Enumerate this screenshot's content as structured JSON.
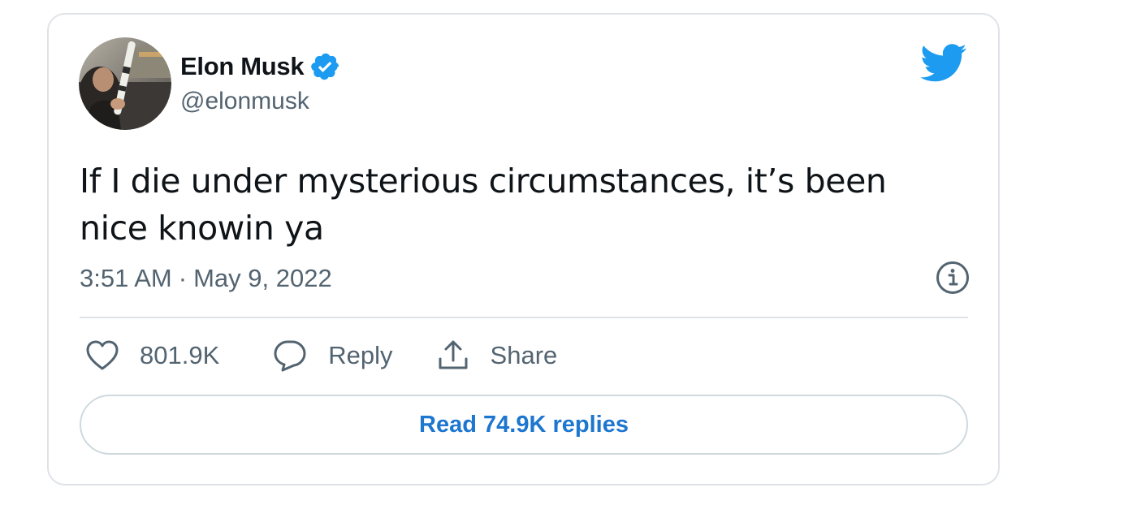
{
  "author": {
    "name": "Elon Musk",
    "handle": "@elonmusk",
    "verified": true
  },
  "tweet": {
    "text": "If I die under mysterious circumstances, it’s been nice knowin ya",
    "time": "3:51 AM",
    "separator": "·",
    "date": "May 9, 2022"
  },
  "actions": {
    "likes": "801.9K",
    "reply_label": "Reply",
    "share_label": "Share"
  },
  "read_replies_label": "Read 74.9K replies",
  "icons": {
    "brand": "twitter-bird-icon",
    "verified": "verified-badge-icon",
    "info": "info-icon",
    "like": "heart-icon",
    "reply": "reply-bubble-icon",
    "share": "share-upload-icon"
  },
  "colors": {
    "brand_blue": "#1d9bf0",
    "link_blue": "#1d76cf",
    "text_primary": "#0f1419",
    "text_secondary": "#536471",
    "border": "#dfe3e7"
  }
}
